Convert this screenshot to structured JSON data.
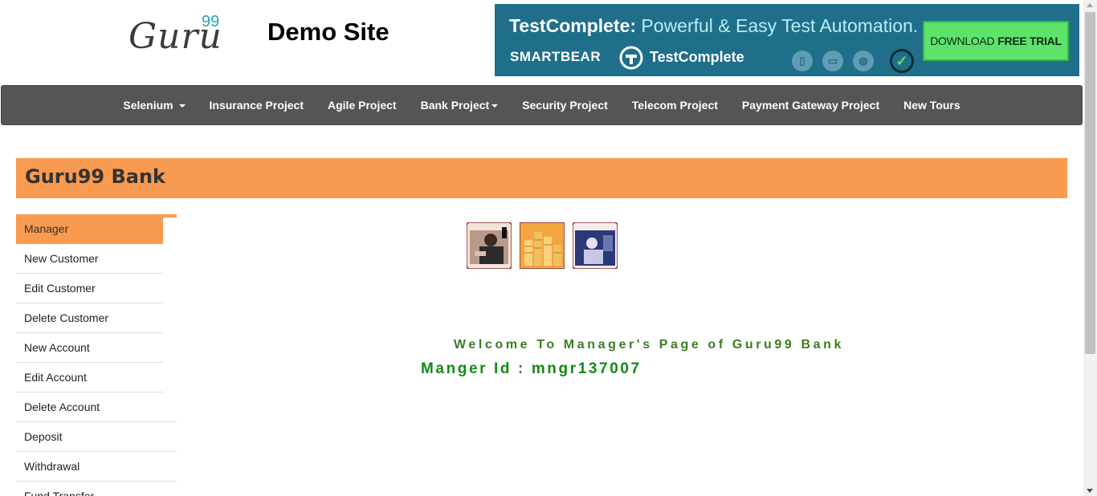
{
  "header": {
    "logo_text": "Guru",
    "logo_sup": "99",
    "site_title": "Demo Site"
  },
  "ad": {
    "headline_bold": "TestComplete:",
    "headline_light": " Powerful & Easy Test Automation.",
    "brand": "SMARTBEAR",
    "product": "TestComplete",
    "cta_prefix": "DOWNLOAD",
    "cta_bold": "FREE TRIAL"
  },
  "nav": {
    "items": [
      {
        "label": "Selenium",
        "dropdown": true
      },
      {
        "label": "Insurance Project",
        "dropdown": false
      },
      {
        "label": "Agile Project",
        "dropdown": false
      },
      {
        "label": "Bank Project",
        "dropdown": true
      },
      {
        "label": "Security Project",
        "dropdown": false
      },
      {
        "label": "Telecom Project",
        "dropdown": false
      },
      {
        "label": "Payment Gateway Project",
        "dropdown": false
      },
      {
        "label": "New Tours",
        "dropdown": false
      }
    ]
  },
  "bank": {
    "title": "Guru99 Bank"
  },
  "sidebar": {
    "items": [
      {
        "label": "Manager",
        "active": true
      },
      {
        "label": "New Customer"
      },
      {
        "label": "Edit Customer"
      },
      {
        "label": "Delete Customer"
      },
      {
        "label": "New Account"
      },
      {
        "label": "Edit Account"
      },
      {
        "label": "Delete Account"
      },
      {
        "label": "Deposit"
      },
      {
        "label": "Withdrawal"
      },
      {
        "label": "Fund Transfer"
      }
    ]
  },
  "main": {
    "welcome": "Welcome To Manager's Page of Guru99 Bank",
    "manager_id": "Manger Id : mngr137007"
  },
  "colors": {
    "accent_orange": "#f89a4f",
    "nav_bg": "#555555",
    "welcome_green": "#3b7d23",
    "manager_green": "#148a14"
  }
}
